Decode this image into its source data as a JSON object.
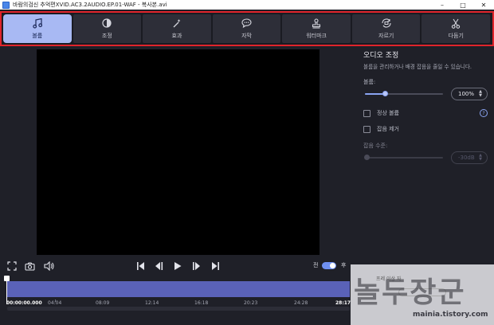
{
  "window": {
    "title": "바람의검신 추억편XVID.AC3.2AUDIO.EP.01-WAF - 복사본.avi",
    "minimize": "–",
    "maximize": "□",
    "close": "✕"
  },
  "toolbar": {
    "tabs": [
      {
        "label": "볼륨",
        "icon": "music-note-icon"
      },
      {
        "label": "조정",
        "icon": "contrast-icon"
      },
      {
        "label": "효과",
        "icon": "magic-wand-icon"
      },
      {
        "label": "자막",
        "icon": "speech-bubble-icon"
      },
      {
        "label": "워터마크",
        "icon": "stamp-icon"
      },
      {
        "label": "자르기",
        "icon": "rotate-crop-icon"
      },
      {
        "label": "다듬기",
        "icon": "scissors-icon"
      }
    ],
    "active_index": 0
  },
  "panel": {
    "title": "오디오 조정",
    "description": "볼륨을 관리하거나 배경 잡음을 줄일 수 있습니다.",
    "volume_label": "볼륨:",
    "volume_value": "100%",
    "volume_level": 0.26,
    "normal_volume_label": "정상 볼륨",
    "noise_remove_label": "잡음 제거",
    "noise_level_label": "잡음 수준:",
    "noise_value": "-30dB",
    "help": "?"
  },
  "controls": {
    "toggle_before": "전",
    "toggle_after": "후"
  },
  "timeline": {
    "current_time": "00:00:00.000",
    "ticks": [
      "04:04",
      "08:09",
      "12:14",
      "16:18",
      "20:23",
      "24:28",
      "28:17"
    ]
  },
  "watermark": {
    "text": "놀두장군",
    "url": "mainia.tistory.com",
    "ghost_text": "프레 이상 자"
  },
  "colors": {
    "accent": "#8aa4f2",
    "active_tab": "#a8b9f3",
    "highlight_border": "#e0242b",
    "clip": "#5a62b8"
  }
}
